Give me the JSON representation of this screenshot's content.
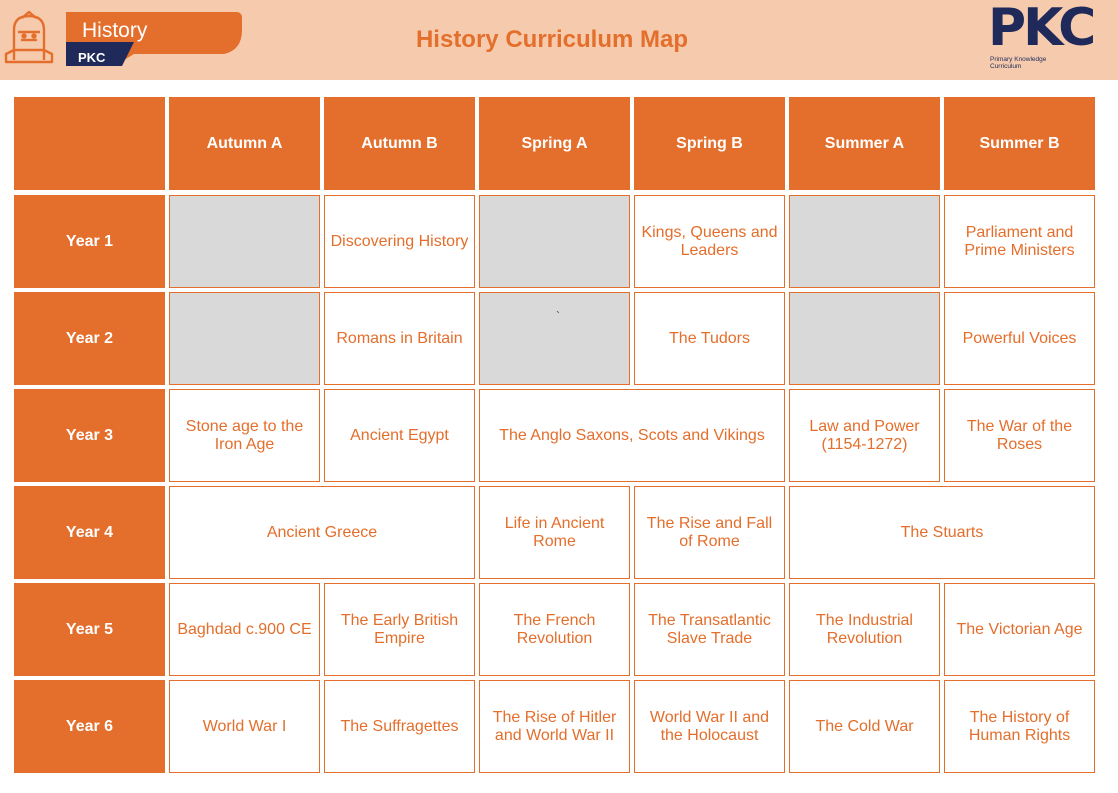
{
  "header": {
    "badge_title": "History",
    "badge_sub": "PKC",
    "page_title": "History Curriculum Map",
    "brand": "PKC",
    "brand_sub_line1": "Primary Knowledge",
    "brand_sub_line2": "Curriculum"
  },
  "colors": {
    "accent": "#e46e2b",
    "header_bg": "#f6cbad",
    "empty_cell": "#d9d9d9",
    "brand_navy": "#1f2a5a"
  },
  "table": {
    "columns": [
      "Autumn A",
      "Autumn B",
      "Spring A",
      "Spring B",
      "Summer A",
      "Summer B"
    ],
    "rows": [
      {
        "label": "Year 1",
        "cells": [
          {
            "text": "",
            "empty": true
          },
          {
            "text": "Discovering History"
          },
          {
            "text": "",
            "empty": true
          },
          {
            "text": "Kings, Queens and Leaders"
          },
          {
            "text": "",
            "empty": true
          },
          {
            "text": "Parliament and Prime Ministers"
          }
        ]
      },
      {
        "label": "Year 2",
        "cells": [
          {
            "text": "",
            "empty": true
          },
          {
            "text": "Romans in Britain"
          },
          {
            "text": "",
            "empty": true,
            "mark": "`"
          },
          {
            "text": "The Tudors"
          },
          {
            "text": "",
            "empty": true
          },
          {
            "text": "Powerful Voices"
          }
        ]
      },
      {
        "label": "Year 3",
        "cells": [
          {
            "text": "Stone age to the Iron Age"
          },
          {
            "text": "Ancient Egypt"
          },
          {
            "text": "The Anglo Saxons, Scots and Vikings",
            "span": 2
          },
          {
            "text": "Law and Power (1154-1272)"
          },
          {
            "text": "The War of the Roses"
          }
        ]
      },
      {
        "label": "Year 4",
        "cells": [
          {
            "text": "Ancient Greece",
            "span": 2
          },
          {
            "text": "Life in Ancient Rome"
          },
          {
            "text": "The Rise and Fall of Rome"
          },
          {
            "text": "The Stuarts",
            "span": 2
          }
        ]
      },
      {
        "label": "Year 5",
        "cells": [
          {
            "text": "Baghdad c.900 CE"
          },
          {
            "text": "The Early British Empire"
          },
          {
            "text": "The French Revolution"
          },
          {
            "text": "The Transatlantic Slave Trade"
          },
          {
            "text": "The Industrial Revolution"
          },
          {
            "text": "The Victorian Age"
          }
        ]
      },
      {
        "label": "Year 6",
        "cells": [
          {
            "text": "World War I"
          },
          {
            "text": "The Suffragettes"
          },
          {
            "text": "The Rise of Hitler and World War II"
          },
          {
            "text": "World War II and the Holocaust"
          },
          {
            "text": "The Cold War"
          },
          {
            "text": "The History of Human Rights"
          }
        ]
      }
    ]
  }
}
